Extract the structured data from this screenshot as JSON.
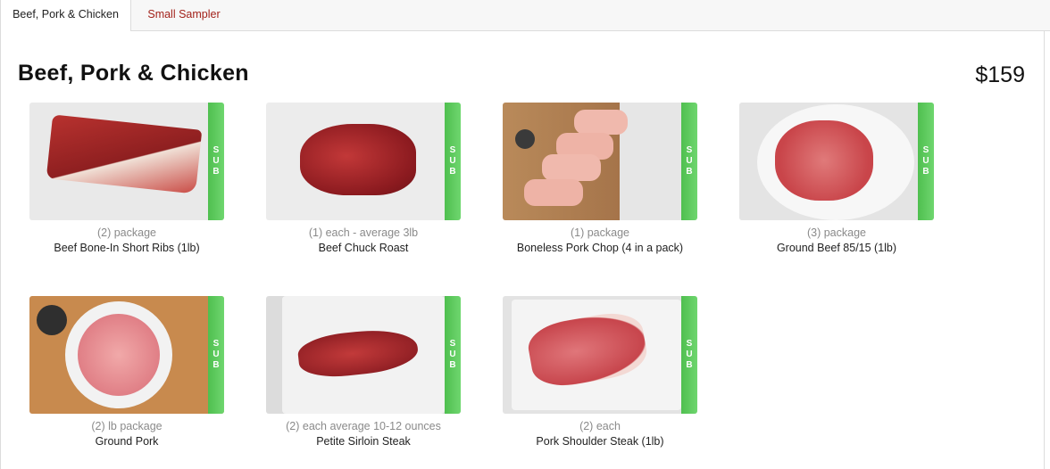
{
  "tabs": [
    {
      "label": "Beef, Pork & Chicken",
      "active": true
    },
    {
      "label": "Small Sampler",
      "active": false
    }
  ],
  "section": {
    "title": "Beef, Pork & Chicken",
    "price": "$159",
    "sub_label": "SUB"
  },
  "products": [
    {
      "qty": "(2) package",
      "name": "Beef Bone-In Short Ribs (1lb)"
    },
    {
      "qty": "(1) each - average 3lb",
      "name": "Beef Chuck Roast"
    },
    {
      "qty": "(1) package",
      "name": "Boneless Pork Chop (4 in a pack)"
    },
    {
      "qty": "(3) package",
      "name": "Ground Beef 85/15 (1lb)"
    },
    {
      "qty": "(2) lb package",
      "name": "Ground Pork"
    },
    {
      "qty": "(2) each average 10-12 ounces",
      "name": "Petite Sirloin Steak"
    },
    {
      "qty": "(2) each",
      "name": "Pork Shoulder Steak (1lb)"
    }
  ],
  "colors": {
    "accent": "#a3231c",
    "sub_green": "#5cc95c"
  }
}
